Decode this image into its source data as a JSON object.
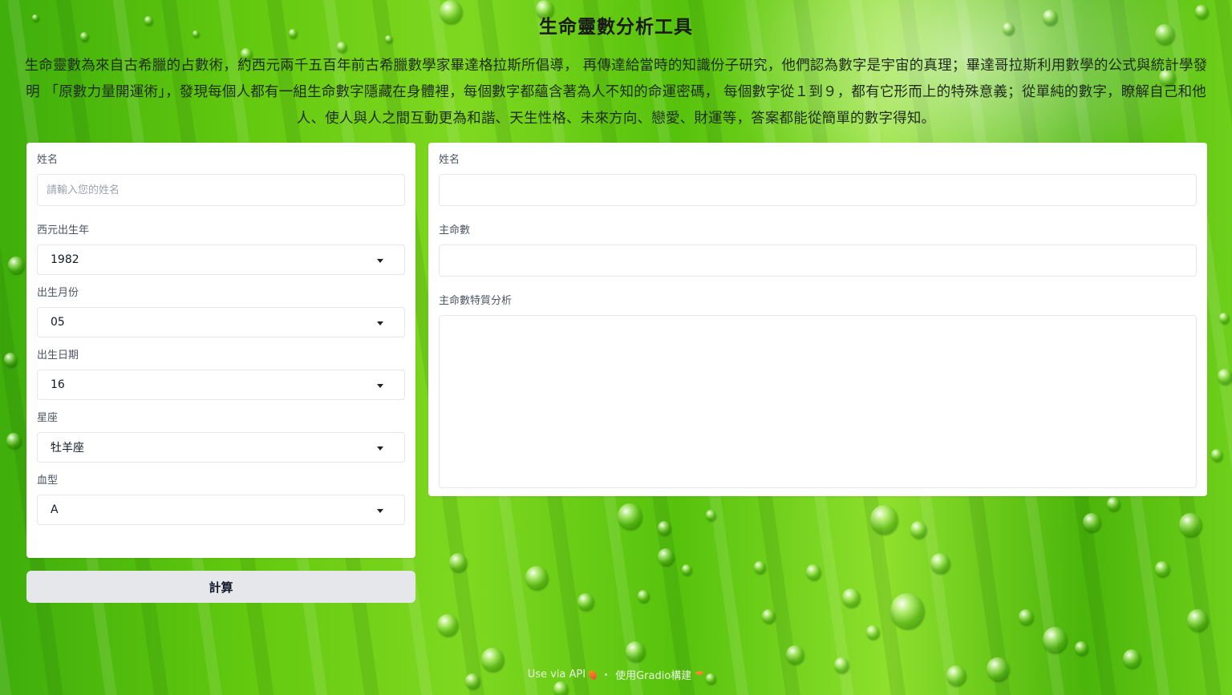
{
  "page": {
    "title": "生命靈數分析工具",
    "intro": "生命靈數為來自古希臘的占數術，約西元兩千五百年前古希臘數學家畢達格拉斯所倡導， 再傳達給當時的知識份子研究，他們認為數字是宇宙的真理；畢達哥拉斯利用數學的公式與統計學發明 「原數力量開運術」，發現每個人都有一組生命數字隱藏在身體裡，每個數字都蘊含著為人不知的命運密碼， 每個數字從１到９，都有它形而上的特殊意義；從單純的數字，瞭解自己和他人、使人與人之間互動更為和諧、天生性格、未來方向、戀愛、財運等，答案都能從簡單的數字得知。"
  },
  "form": {
    "name_label": "姓名",
    "name_placeholder": "請輸入您的姓名",
    "name_value": "",
    "year_label": "西元出生年",
    "year_value": "1982",
    "month_label": "出生月份",
    "month_value": "05",
    "day_label": "出生日期",
    "day_value": "16",
    "zodiac_label": "星座",
    "zodiac_value": "牡羊座",
    "blood_label": "血型",
    "blood_value": "A",
    "submit_label": "計算"
  },
  "output": {
    "name_label": "姓名",
    "name_value": "",
    "main_number_label": "主命數",
    "main_number_value": "",
    "analysis_label": "主命數特質分析",
    "analysis_value": ""
  },
  "footer": {
    "api_label": "Use via API",
    "separator": "·",
    "built_label": "使用Gradio構建"
  },
  "icons": {
    "api": "rocket-icon",
    "gradio": "gradio-logo-icon",
    "dropdown": "chevron-down-icon"
  }
}
